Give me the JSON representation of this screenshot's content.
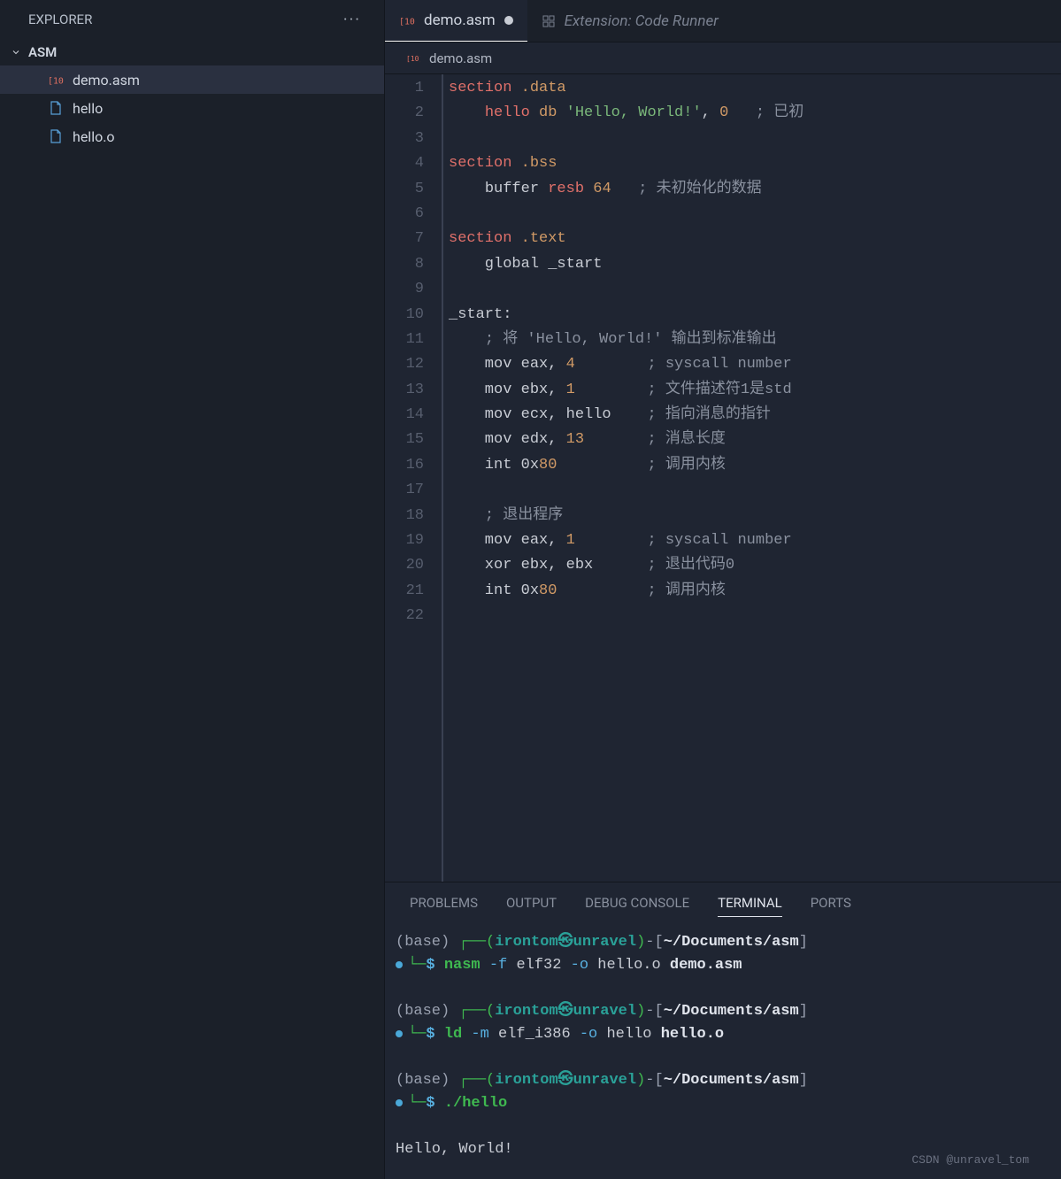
{
  "sidebar": {
    "title": "EXPLORER",
    "folder": "ASM",
    "files": [
      {
        "name": "demo.asm",
        "icon": "asm",
        "active": true
      },
      {
        "name": "hello",
        "icon": "file",
        "active": false
      },
      {
        "name": "hello.o",
        "icon": "file",
        "active": false
      }
    ]
  },
  "tabs": {
    "active": {
      "name": "demo.asm",
      "dirty": true
    },
    "inactive": {
      "name": "Extension: Code Runner"
    }
  },
  "breadcrumb": {
    "file": "demo.asm"
  },
  "editor": {
    "line_count": 22,
    "lines": [
      [
        {
          "t": "section ",
          "c": "kw"
        },
        {
          "t": ".data",
          "c": "sect"
        }
      ],
      [
        {
          "t": "    ",
          "c": "id"
        },
        {
          "t": "hello ",
          "c": "kw"
        },
        {
          "t": "db ",
          "c": "sect"
        },
        {
          "t": "'Hello, World!'",
          "c": "str"
        },
        {
          "t": ", ",
          "c": "id"
        },
        {
          "t": "0",
          "c": "sect"
        },
        {
          "t": "   ",
          "c": "id"
        },
        {
          "t": "; 已初",
          "c": "cmt"
        }
      ],
      [
        {
          "t": "",
          "c": "id"
        }
      ],
      [
        {
          "t": "section ",
          "c": "kw"
        },
        {
          "t": ".bss",
          "c": "sect"
        }
      ],
      [
        {
          "t": "    ",
          "c": "id"
        },
        {
          "t": "buffer ",
          "c": "id"
        },
        {
          "t": "resb ",
          "c": "kw"
        },
        {
          "t": "64",
          "c": "sect"
        },
        {
          "t": "   ",
          "c": "id"
        },
        {
          "t": "; 未初始化的数据",
          "c": "cmt"
        }
      ],
      [
        {
          "t": "",
          "c": "id"
        }
      ],
      [
        {
          "t": "section ",
          "c": "kw"
        },
        {
          "t": ".text",
          "c": "sect"
        }
      ],
      [
        {
          "t": "    global _start",
          "c": "id"
        }
      ],
      [
        {
          "t": "",
          "c": "id"
        }
      ],
      [
        {
          "t": "_start:",
          "c": "id"
        }
      ],
      [
        {
          "t": "    ",
          "c": "id"
        },
        {
          "t": "; 将 'Hello, World!' 输出到标准输出",
          "c": "cmt"
        }
      ],
      [
        {
          "t": "    mov eax, ",
          "c": "id"
        },
        {
          "t": "4",
          "c": "sect"
        },
        {
          "t": "        ",
          "c": "id"
        },
        {
          "t": "; syscall number",
          "c": "cmt"
        }
      ],
      [
        {
          "t": "    mov ebx, ",
          "c": "id"
        },
        {
          "t": "1",
          "c": "sect"
        },
        {
          "t": "        ",
          "c": "id"
        },
        {
          "t": "; 文件描述符1是std",
          "c": "cmt"
        }
      ],
      [
        {
          "t": "    mov ecx, hello    ",
          "c": "id"
        },
        {
          "t": "; 指向消息的指针",
          "c": "cmt"
        }
      ],
      [
        {
          "t": "    mov edx, ",
          "c": "id"
        },
        {
          "t": "13",
          "c": "sect"
        },
        {
          "t": "       ",
          "c": "id"
        },
        {
          "t": "; 消息长度",
          "c": "cmt"
        }
      ],
      [
        {
          "t": "    int 0x",
          "c": "id"
        },
        {
          "t": "80",
          "c": "sect"
        },
        {
          "t": "          ",
          "c": "id"
        },
        {
          "t": "; 调用内核",
          "c": "cmt"
        }
      ],
      [
        {
          "t": "",
          "c": "id"
        }
      ],
      [
        {
          "t": "    ",
          "c": "id"
        },
        {
          "t": "; 退出程序",
          "c": "cmt"
        }
      ],
      [
        {
          "t": "    mov eax, ",
          "c": "id"
        },
        {
          "t": "1",
          "c": "sect"
        },
        {
          "t": "        ",
          "c": "id"
        },
        {
          "t": "; syscall number",
          "c": "cmt"
        }
      ],
      [
        {
          "t": "    xor ebx, ebx      ",
          "c": "id"
        },
        {
          "t": "; 退出代码0",
          "c": "cmt"
        }
      ],
      [
        {
          "t": "    int 0x",
          "c": "id"
        },
        {
          "t": "80",
          "c": "sect"
        },
        {
          "t": "          ",
          "c": "id"
        },
        {
          "t": "; 调用内核",
          "c": "cmt"
        }
      ],
      [
        {
          "t": "",
          "c": "id"
        }
      ]
    ]
  },
  "panel": {
    "tabs": [
      "PROBLEMS",
      "OUTPUT",
      "DEBUG CONSOLE",
      "TERMINAL",
      "PORTS"
    ],
    "active_tab": "TERMINAL"
  },
  "terminal": {
    "prompt": {
      "base": "(base)",
      "user": "irontom",
      "at": "㉿",
      "host": "unravel",
      "path": "~/Documents/asm"
    },
    "commands": [
      {
        "cmd": "nasm",
        "args": [
          {
            "t": "-f",
            "f": true
          },
          {
            "t": "elf32"
          },
          {
            "t": "-o",
            "f": true
          },
          {
            "t": "hello.o"
          },
          {
            "t": "demo.asm",
            "b": true
          }
        ]
      },
      {
        "cmd": "ld",
        "args": [
          {
            "t": "-m",
            "f": true
          },
          {
            "t": "elf_i386"
          },
          {
            "t": "-o",
            "f": true
          },
          {
            "t": "hello"
          },
          {
            "t": "hello.o",
            "b": true
          }
        ]
      },
      {
        "cmd": "./hello",
        "args": []
      }
    ],
    "output": "Hello, World!"
  },
  "watermark": "CSDN @unravel_tom"
}
